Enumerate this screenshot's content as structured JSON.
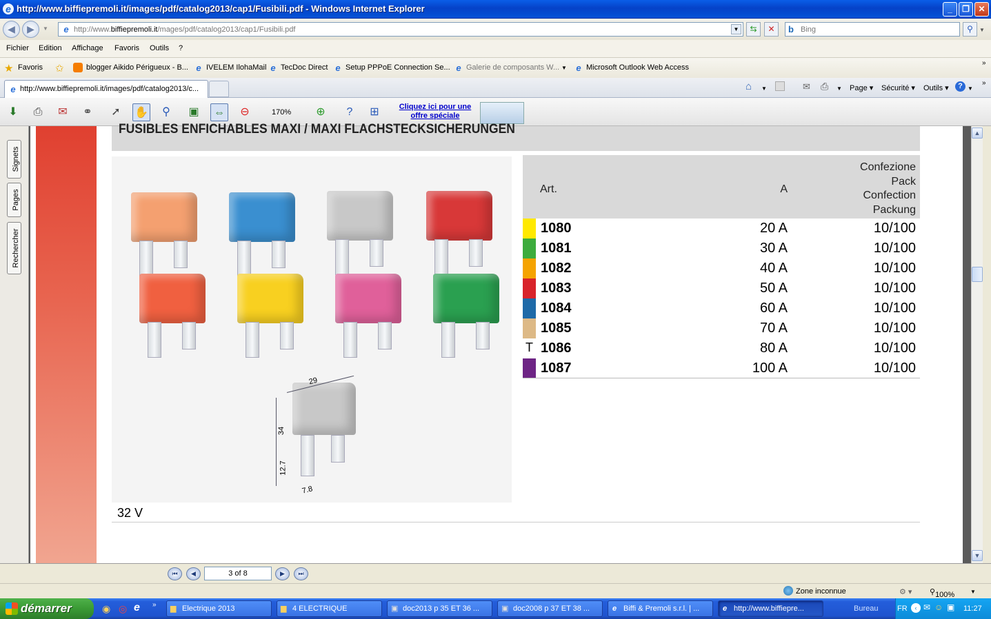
{
  "window": {
    "title": "http://www.biffiepremoli.it/images/pdf/catalog2013/cap1/Fusibili.pdf - Windows Internet Explorer"
  },
  "addressbar": {
    "url_prefix": "http://www.",
    "url_domain": "biffiepremoli.it",
    "url_path": "/mages/pdf/catalog2013/cap1/Fusibili.pdf",
    "search_placeholder": "Bing"
  },
  "menu": [
    "Fichier",
    "Edition",
    "Affichage",
    "Favoris",
    "Outils",
    "?"
  ],
  "favorites": {
    "label": "Favoris",
    "items": [
      "blogger Aikido Périgueux - B...",
      "IVELEM IlohaMail",
      "TecDoc Direct",
      "Setup PPPoE Connection Se...",
      "Galerie de composants W...",
      "Microsoft Outlook Web Access"
    ]
  },
  "tab": {
    "title": "http://www.biffiepremoli.it/images/pdf/catalog2013/c..."
  },
  "commandbar": {
    "page": "Page",
    "security": "Sécurité",
    "tools": "Outils"
  },
  "pdf_toolbar": {
    "zoom": "170%",
    "promo_line1": "Cliquez ici pour une",
    "promo_line2": "offre spéciale"
  },
  "sidepanel": {
    "tabs": [
      "Signets",
      "Pages",
      "Rechercher"
    ]
  },
  "document": {
    "heading": "FUSIBLES ENFICHABLES MAXI / MAXI FLACHSTECKSICHERUNGEN",
    "table_header": {
      "art": "Art.",
      "amp": "A",
      "pack": [
        "Confezione",
        "Pack",
        "Confection",
        "Packung"
      ]
    },
    "rows": [
      {
        "swatch": "#ffe900",
        "prefix": "",
        "art": "1080",
        "amp": "20 A",
        "pack": "10/100"
      },
      {
        "swatch": "#3dac3d",
        "prefix": "",
        "art": "1081",
        "amp": "30 A",
        "pack": "10/100"
      },
      {
        "swatch": "#f5a300",
        "prefix": "",
        "art": "1082",
        "amp": "40 A",
        "pack": "10/100"
      },
      {
        "swatch": "#d8232a",
        "prefix": "",
        "art": "1083",
        "amp": "50 A",
        "pack": "10/100"
      },
      {
        "swatch": "#1e6aa8",
        "prefix": "",
        "art": "1084",
        "amp": "60 A",
        "pack": "10/100"
      },
      {
        "swatch": "#ddb986",
        "prefix": "",
        "art": "1085",
        "amp": "70 A",
        "pack": "10/100"
      },
      {
        "swatch": "#ffffff",
        "prefix": "T",
        "art": "1086",
        "amp": "80 A",
        "pack": "10/100"
      },
      {
        "swatch": "#6e2585",
        "prefix": "",
        "art": "1087",
        "amp": "100 A",
        "pack": "10/100"
      }
    ],
    "dimensions": {
      "width": "29",
      "height": "34",
      "leg": "12.7",
      "leg_width": "7.8"
    },
    "voltage": "32 V"
  },
  "pager": {
    "page": "3 of 8"
  },
  "statusbar": {
    "zone": "Zone inconnue",
    "zoom": "100%"
  },
  "taskbar": {
    "start": "démarrer",
    "tasks": [
      "Electrique 2013",
      "4 ELECTRIQUE",
      "doc2013 p 35 ET 36 ...",
      "doc2008 p 37 ET 38 ...",
      "Biffi & Premoli s.r.l. | ...",
      "http://www.biffiepre..."
    ],
    "desktop": "Bureau",
    "lang": "FR",
    "clock": "11:27"
  },
  "fuse_colors": [
    "#f4a070",
    "#3a8fd0",
    "#c8c8c8",
    "#d83838",
    "#f06040",
    "#f8d020",
    "#e0609a",
    "#2aa050"
  ]
}
